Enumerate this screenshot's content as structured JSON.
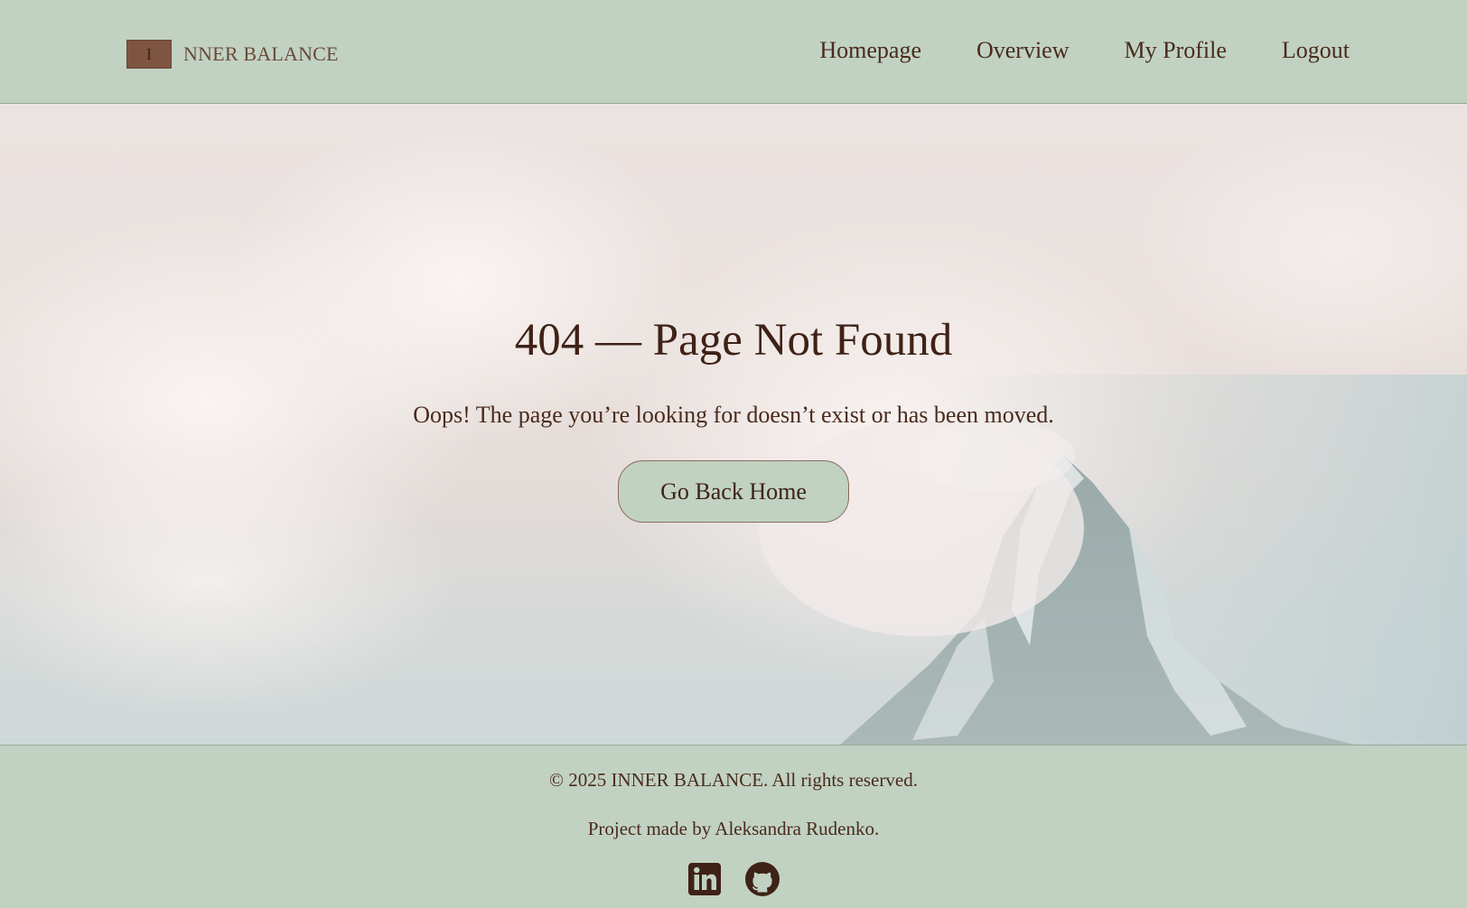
{
  "header": {
    "logo_mark": "I",
    "logo_text": "NNER BALANCE",
    "nav": [
      {
        "label": "Homepage"
      },
      {
        "label": "Overview"
      },
      {
        "label": "My Profile"
      },
      {
        "label": "Logout"
      }
    ]
  },
  "main": {
    "title": "404 — Page Not Found",
    "message": "Oops! The page you’re looking for doesn’t exist or has been moved.",
    "home_button_label": "Go Back Home"
  },
  "footer": {
    "copyright": "© 2025 INNER BALANCE. All rights reserved.",
    "credit": "Project made by Aleksandra Rudenko.",
    "socials": [
      {
        "icon": "linkedin-icon"
      },
      {
        "icon": "github-icon"
      }
    ]
  },
  "colors": {
    "header_footer_bg": "#c1d2c2",
    "text_brown": "#3f2216",
    "logo_brown": "#7d5540",
    "button_bg": "#c1d2c2"
  }
}
